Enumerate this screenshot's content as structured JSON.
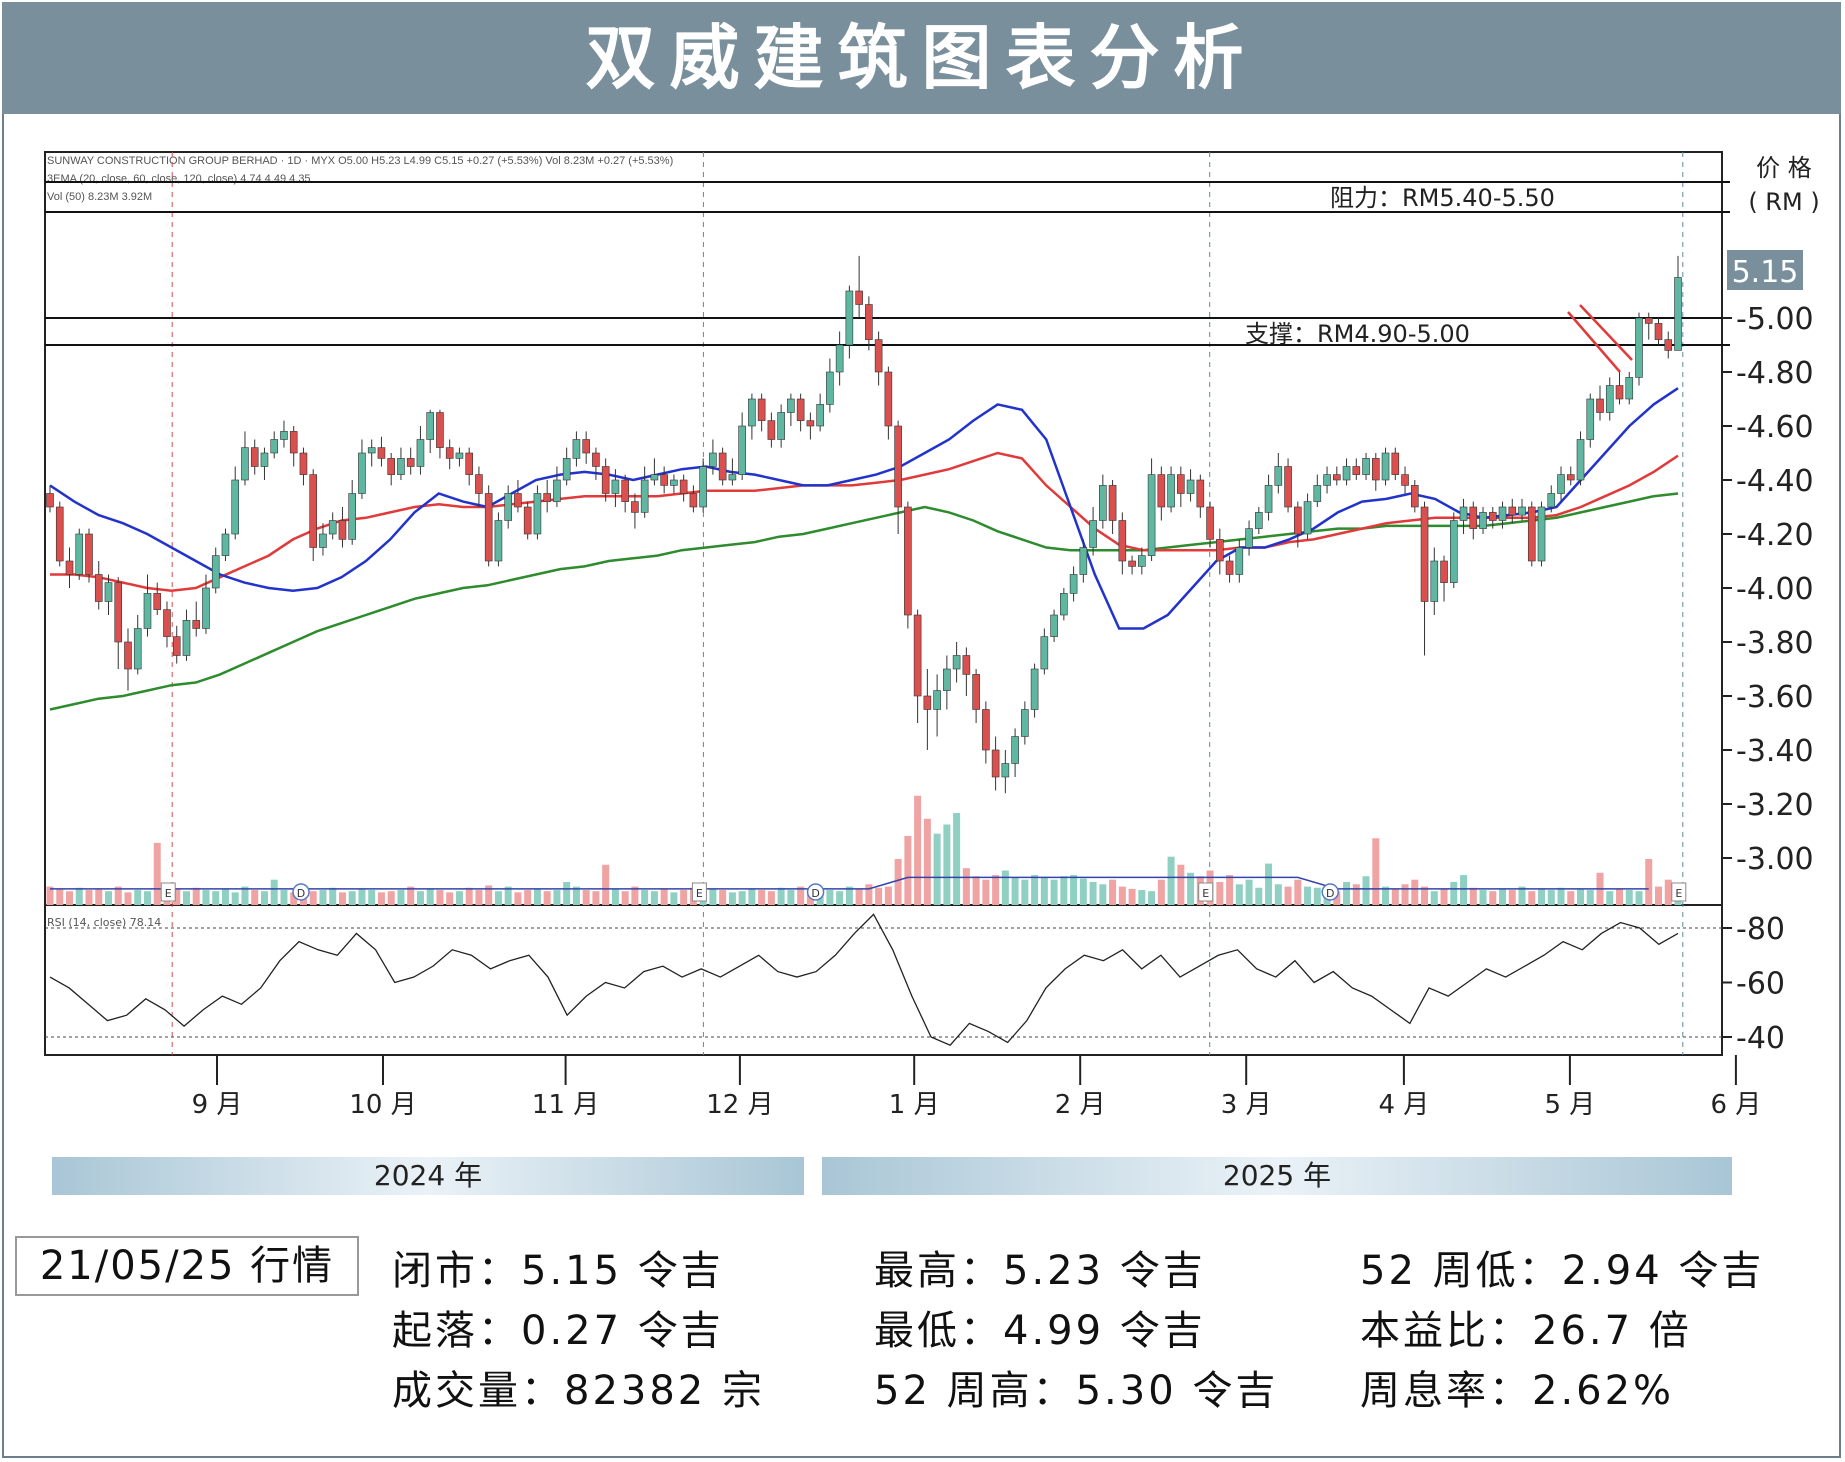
{
  "title": "双威建筑图表分析",
  "chart_data": {
    "type": "candlestick",
    "header_lines": [
      "SUNWAY CONSTRUCTION GROUP BERHAD · 1D · MYX  O5.00  H5.23  L4.99  C5.15  +0.27 (+5.53%)  Vol 8.23M +0.27 (+5.53%)",
      "3EMA (20, close, 60, close, 120, close)  4.74  4.49  4.35",
      "Vol (50)  8.23M  3.92M"
    ],
    "y_axis_title": "价 格",
    "y_axis_unit": "( RM )",
    "price_ticks": [
      "5.00",
      "4.80",
      "4.60",
      "4.40",
      "4.20",
      "4.00",
      "3.80",
      "3.60",
      "3.40",
      "3.20",
      "3.00"
    ],
    "ylim": [
      2.9,
      5.68
    ],
    "last_price_label": "5.15",
    "resistance": {
      "label": "阻力：RM5.40-5.50",
      "low": 5.4,
      "high": 5.5
    },
    "support": {
      "label": "支撑：RM4.90-5.00",
      "low": 4.9,
      "high": 5.0
    },
    "x_ticks": [
      "9 月",
      "10 月",
      "11 月",
      "12 月",
      "1 月",
      "2 月",
      "3 月",
      "4 月",
      "5 月",
      "6 月"
    ],
    "x_tick_pos": [
      0.5,
      1.5,
      2.6,
      3.65,
      4.7,
      5.7,
      6.7,
      7.65,
      8.65,
      9.65
    ],
    "years": [
      "2024 年",
      "2025 年"
    ],
    "event_markers": [
      {
        "label": "E",
        "x": 0.2
      },
      {
        "label": "D",
        "x": 1.0
      },
      {
        "label": "E",
        "x": 3.4
      },
      {
        "label": "D",
        "x": 4.1
      },
      {
        "label": "E",
        "x": 6.45
      },
      {
        "label": "D",
        "x": 7.2
      },
      {
        "label": "E",
        "x": 9.3
      }
    ],
    "rsi_label": "RSI (14, close)  78.14",
    "rsi_ticks": [
      "80",
      "60",
      "40"
    ],
    "rsi_levels": [
      80,
      40
    ],
    "candles": [
      [
        4.35,
        4.3,
        4.38,
        4.28
      ],
      [
        4.3,
        4.1,
        4.32,
        4.08
      ],
      [
        4.1,
        4.05,
        4.15,
        4.0
      ],
      [
        4.05,
        4.2,
        4.22,
        4.03
      ],
      [
        4.2,
        4.05,
        4.22,
        4.02
      ],
      [
        4.05,
        3.95,
        4.1,
        3.92
      ],
      [
        3.95,
        4.02,
        4.05,
        3.9
      ],
      [
        4.02,
        3.8,
        4.04,
        3.7
      ],
      [
        3.8,
        3.7,
        3.85,
        3.62
      ],
      [
        3.7,
        3.85,
        3.9,
        3.68
      ],
      [
        3.85,
        3.98,
        4.05,
        3.82
      ],
      [
        3.98,
        3.92,
        4.02,
        3.9
      ],
      [
        3.92,
        3.82,
        3.95,
        3.78
      ],
      [
        3.82,
        3.75,
        3.86,
        3.72
      ],
      [
        3.75,
        3.88,
        3.92,
        3.73
      ],
      [
        3.88,
        3.85,
        3.95,
        3.82
      ],
      [
        3.85,
        4.0,
        4.05,
        3.83
      ],
      [
        4.0,
        4.12,
        4.15,
        3.98
      ],
      [
        4.12,
        4.2,
        4.22,
        4.1
      ],
      [
        4.2,
        4.4,
        4.45,
        4.18
      ],
      [
        4.4,
        4.52,
        4.58,
        4.38
      ],
      [
        4.52,
        4.45,
        4.55,
        4.42
      ],
      [
        4.45,
        4.5,
        4.52,
        4.4
      ],
      [
        4.5,
        4.55,
        4.58,
        4.48
      ],
      [
        4.55,
        4.58,
        4.62,
        4.52
      ],
      [
        4.58,
        4.5,
        4.6,
        4.45
      ],
      [
        4.5,
        4.42,
        4.52,
        4.38
      ],
      [
        4.42,
        4.15,
        4.44,
        4.1
      ],
      [
        4.15,
        4.2,
        4.24,
        4.12
      ],
      [
        4.2,
        4.25,
        4.28,
        4.18
      ],
      [
        4.25,
        4.18,
        4.3,
        4.15
      ],
      [
        4.18,
        4.35,
        4.4,
        4.16
      ],
      [
        4.35,
        4.5,
        4.55,
        4.33
      ],
      [
        4.5,
        4.52,
        4.55,
        4.45
      ],
      [
        4.52,
        4.48,
        4.56,
        4.45
      ],
      [
        4.48,
        4.42,
        4.5,
        4.38
      ],
      [
        4.42,
        4.48,
        4.52,
        4.4
      ],
      [
        4.48,
        4.45,
        4.52,
        4.42
      ],
      [
        4.45,
        4.55,
        4.6,
        4.42
      ],
      [
        4.55,
        4.65,
        4.66,
        4.5
      ],
      [
        4.65,
        4.52,
        4.66,
        4.48
      ],
      [
        4.52,
        4.48,
        4.55,
        4.44
      ],
      [
        4.48,
        4.5,
        4.52,
        4.45
      ],
      [
        4.5,
        4.42,
        4.52,
        4.38
      ],
      [
        4.42,
        4.35,
        4.45,
        4.3
      ],
      [
        4.35,
        4.1,
        4.38,
        4.08
      ],
      [
        4.1,
        4.25,
        4.28,
        4.08
      ],
      [
        4.25,
        4.35,
        4.38,
        4.22
      ],
      [
        4.35,
        4.3,
        4.4,
        4.28
      ],
      [
        4.3,
        4.2,
        4.32,
        4.18
      ],
      [
        4.2,
        4.35,
        4.38,
        4.18
      ],
      [
        4.35,
        4.32,
        4.4,
        4.28
      ],
      [
        4.32,
        4.4,
        4.45,
        4.3
      ],
      [
        4.4,
        4.48,
        4.52,
        4.38
      ],
      [
        4.48,
        4.55,
        4.58,
        4.45
      ],
      [
        4.55,
        4.5,
        4.58,
        4.46
      ],
      [
        4.5,
        4.45,
        4.52,
        4.4
      ],
      [
        4.45,
        4.35,
        4.48,
        4.32
      ],
      [
        4.35,
        4.4,
        4.44,
        4.3
      ],
      [
        4.4,
        4.32,
        4.42,
        4.28
      ],
      [
        4.32,
        4.28,
        4.35,
        4.22
      ],
      [
        4.28,
        4.4,
        4.45,
        4.26
      ],
      [
        4.4,
        4.42,
        4.48,
        4.38
      ],
      [
        4.42,
        4.38,
        4.45,
        4.35
      ],
      [
        4.38,
        4.4,
        4.42,
        4.35
      ],
      [
        4.4,
        4.35,
        4.42,
        4.32
      ],
      [
        4.35,
        4.3,
        4.38,
        4.28
      ],
      [
        4.3,
        4.45,
        4.48,
        4.28
      ],
      [
        4.45,
        4.5,
        4.55,
        4.42
      ],
      [
        4.5,
        4.4,
        4.52,
        4.38
      ],
      [
        4.4,
        4.42,
        4.48,
        4.38
      ],
      [
        4.42,
        4.6,
        4.65,
        4.4
      ],
      [
        4.6,
        4.7,
        4.72,
        4.55
      ],
      [
        4.7,
        4.62,
        4.72,
        4.58
      ],
      [
        4.62,
        4.55,
        4.65,
        4.52
      ],
      [
        4.55,
        4.65,
        4.68,
        4.52
      ],
      [
        4.65,
        4.7,
        4.72,
        4.6
      ],
      [
        4.7,
        4.62,
        4.72,
        4.58
      ],
      [
        4.62,
        4.6,
        4.65,
        4.55
      ],
      [
        4.6,
        4.68,
        4.72,
        4.58
      ],
      [
        4.68,
        4.8,
        4.85,
        4.65
      ],
      [
        4.8,
        4.9,
        4.95,
        4.75
      ],
      [
        4.9,
        5.1,
        5.12,
        4.85
      ],
      [
        5.1,
        5.05,
        5.23,
        5.0
      ],
      [
        5.05,
        4.92,
        5.08,
        4.88
      ],
      [
        4.92,
        4.8,
        4.95,
        4.75
      ],
      [
        4.8,
        4.6,
        4.82,
        4.55
      ],
      [
        4.6,
        4.3,
        4.62,
        4.2
      ],
      [
        4.3,
        3.9,
        4.32,
        3.85
      ],
      [
        3.9,
        3.6,
        3.92,
        3.5
      ],
      [
        3.6,
        3.55,
        3.7,
        3.4
      ],
      [
        3.55,
        3.62,
        3.68,
        3.45
      ],
      [
        3.62,
        3.7,
        3.75,
        3.55
      ],
      [
        3.7,
        3.75,
        3.8,
        3.65
      ],
      [
        3.75,
        3.68,
        3.78,
        3.6
      ],
      [
        3.68,
        3.55,
        3.7,
        3.5
      ],
      [
        3.55,
        3.4,
        3.58,
        3.35
      ],
      [
        3.4,
        3.3,
        3.45,
        3.25
      ],
      [
        3.3,
        3.35,
        3.4,
        3.24
      ],
      [
        3.35,
        3.45,
        3.48,
        3.3
      ],
      [
        3.45,
        3.55,
        3.58,
        3.42
      ],
      [
        3.55,
        3.7,
        3.72,
        3.52
      ],
      [
        3.7,
        3.82,
        3.85,
        3.68
      ],
      [
        3.82,
        3.9,
        3.92,
        3.8
      ],
      [
        3.9,
        3.98,
        4.0,
        3.88
      ],
      [
        3.98,
        4.05,
        4.08,
        3.95
      ],
      [
        4.05,
        4.15,
        4.18,
        4.02
      ],
      [
        4.15,
        4.25,
        4.3,
        4.12
      ],
      [
        4.25,
        4.38,
        4.42,
        4.22
      ],
      [
        4.38,
        4.25,
        4.4,
        4.2
      ],
      [
        4.25,
        4.1,
        4.28,
        4.05
      ],
      [
        4.1,
        4.08,
        4.12,
        4.05
      ],
      [
        4.08,
        4.12,
        4.15,
        4.05
      ],
      [
        4.12,
        4.42,
        4.48,
        4.1
      ],
      [
        4.42,
        4.3,
        4.45,
        4.25
      ],
      [
        4.3,
        4.42,
        4.45,
        4.28
      ],
      [
        4.42,
        4.35,
        4.45,
        4.3
      ],
      [
        4.35,
        4.4,
        4.44,
        4.32
      ],
      [
        4.4,
        4.3,
        4.42,
        4.26
      ],
      [
        4.3,
        4.18,
        4.32,
        4.15
      ],
      [
        4.18,
        4.1,
        4.22,
        4.05
      ],
      [
        4.1,
        4.05,
        4.12,
        4.02
      ],
      [
        4.05,
        4.15,
        4.18,
        4.02
      ],
      [
        4.15,
        4.22,
        4.25,
        4.12
      ],
      [
        4.22,
        4.28,
        4.3,
        4.2
      ],
      [
        4.28,
        4.38,
        4.42,
        4.25
      ],
      [
        4.38,
        4.45,
        4.5,
        4.35
      ],
      [
        4.45,
        4.3,
        4.48,
        4.28
      ],
      [
        4.3,
        4.2,
        4.32,
        4.15
      ],
      [
        4.2,
        4.32,
        4.35,
        4.18
      ],
      [
        4.32,
        4.38,
        4.42,
        4.3
      ],
      [
        4.38,
        4.42,
        4.45,
        4.35
      ],
      [
        4.42,
        4.4,
        4.45,
        4.38
      ],
      [
        4.4,
        4.45,
        4.48,
        4.38
      ],
      [
        4.45,
        4.42,
        4.48,
        4.4
      ],
      [
        4.42,
        4.48,
        4.5,
        4.4
      ],
      [
        4.48,
        4.4,
        4.5,
        4.36
      ],
      [
        4.4,
        4.5,
        4.52,
        4.38
      ],
      [
        4.5,
        4.42,
        4.52,
        4.4
      ],
      [
        4.42,
        4.38,
        4.45,
        4.35
      ],
      [
        4.38,
        4.3,
        4.4,
        4.28
      ],
      [
        4.3,
        3.95,
        4.32,
        3.75
      ],
      [
        3.95,
        4.1,
        4.15,
        3.9
      ],
      [
        4.1,
        4.02,
        4.12,
        3.95
      ],
      [
        4.02,
        4.25,
        4.28,
        4.0
      ],
      [
        4.25,
        4.3,
        4.33,
        4.2
      ],
      [
        4.3,
        4.22,
        4.32,
        4.18
      ],
      [
        4.22,
        4.28,
        4.3,
        4.2
      ],
      [
        4.28,
        4.25,
        4.3,
        4.22
      ],
      [
        4.25,
        4.3,
        4.32,
        4.22
      ],
      [
        4.3,
        4.27,
        4.33,
        4.24
      ],
      [
        4.27,
        4.3,
        4.33,
        4.25
      ],
      [
        4.3,
        4.1,
        4.32,
        4.08
      ],
      [
        4.1,
        4.3,
        4.32,
        4.08
      ],
      [
        4.3,
        4.35,
        4.38,
        4.28
      ],
      [
        4.35,
        4.42,
        4.45,
        4.32
      ],
      [
        4.42,
        4.4,
        4.45,
        4.38
      ],
      [
        4.4,
        4.55,
        4.58,
        4.38
      ],
      [
        4.55,
        4.7,
        4.72,
        4.52
      ],
      [
        4.7,
        4.65,
        4.75,
        4.62
      ],
      [
        4.65,
        4.75,
        4.78,
        4.62
      ],
      [
        4.75,
        4.7,
        4.8,
        4.68
      ],
      [
        4.7,
        4.78,
        4.8,
        4.68
      ],
      [
        4.78,
        5.0,
        5.02,
        4.75
      ],
      [
        5.0,
        4.98,
        5.02,
        4.92
      ],
      [
        4.98,
        4.92,
        5.0,
        4.9
      ],
      [
        4.92,
        4.88,
        4.95,
        4.85
      ],
      [
        4.88,
        5.15,
        5.23,
        4.99
      ]
    ],
    "ema20": [
      4.38,
      4.32,
      4.27,
      4.24,
      4.2,
      4.15,
      4.1,
      4.05,
      4.02,
      4.0,
      3.99,
      4.0,
      4.04,
      4.1,
      4.18,
      4.28,
      4.35,
      4.32,
      4.3,
      4.35,
      4.4,
      4.42,
      4.43,
      4.42,
      4.4,
      4.42,
      4.44,
      4.45,
      4.43,
      4.42,
      4.4,
      4.38,
      4.38,
      4.4,
      4.42,
      4.45,
      4.5,
      4.55,
      4.62,
      4.68,
      4.66,
      4.55,
      4.3,
      4.05,
      3.85,
      3.85,
      3.9,
      4.0,
      4.1,
      4.15,
      4.15,
      4.18,
      4.22,
      4.28,
      4.32,
      4.33,
      4.35,
      4.33,
      4.28,
      4.26,
      4.27,
      4.28,
      4.3,
      4.4,
      4.5,
      4.6,
      4.68,
      4.74
    ],
    "ema60": [
      4.05,
      4.05,
      4.04,
      4.02,
      4.0,
      3.99,
      4.0,
      4.04,
      4.08,
      4.12,
      4.18,
      4.22,
      4.25,
      4.26,
      4.28,
      4.3,
      4.31,
      4.3,
      4.3,
      4.31,
      4.32,
      4.33,
      4.34,
      4.34,
      4.34,
      4.34,
      4.35,
      4.36,
      4.36,
      4.36,
      4.37,
      4.38,
      4.38,
      4.38,
      4.39,
      4.4,
      4.42,
      4.44,
      4.47,
      4.5,
      4.48,
      4.38,
      4.3,
      4.22,
      4.16,
      4.14,
      4.14,
      4.14,
      4.14,
      4.15,
      4.15,
      4.17,
      4.18,
      4.2,
      4.22,
      4.24,
      4.25,
      4.26,
      4.26,
      4.26,
      4.26,
      4.26,
      4.27,
      4.3,
      4.34,
      4.38,
      4.43,
      4.49
    ],
    "ema120": [
      3.55,
      3.57,
      3.59,
      3.6,
      3.62,
      3.64,
      3.65,
      3.68,
      3.72,
      3.76,
      3.8,
      3.84,
      3.87,
      3.9,
      3.93,
      3.96,
      3.98,
      4.0,
      4.01,
      4.03,
      4.05,
      4.07,
      4.08,
      4.1,
      4.11,
      4.12,
      4.14,
      4.15,
      4.16,
      4.17,
      4.19,
      4.2,
      4.22,
      4.24,
      4.26,
      4.28,
      4.3,
      4.28,
      4.25,
      4.21,
      4.18,
      4.15,
      4.14,
      4.14,
      4.14,
      4.14,
      4.15,
      4.16,
      4.17,
      4.18,
      4.19,
      4.2,
      4.21,
      4.22,
      4.22,
      4.23,
      4.23,
      4.23,
      4.23,
      4.23,
      4.24,
      4.25,
      4.26,
      4.28,
      4.3,
      4.32,
      4.34,
      4.35
    ],
    "rsi": [
      62,
      58,
      52,
      46,
      48,
      54,
      50,
      44,
      50,
      55,
      52,
      58,
      68,
      75,
      72,
      70,
      78,
      72,
      60,
      62,
      66,
      72,
      70,
      65,
      68,
      70,
      62,
      48,
      55,
      60,
      58,
      64,
      66,
      62,
      65,
      62,
      66,
      70,
      64,
      62,
      64,
      70,
      78,
      85,
      72,
      55,
      40,
      37,
      45,
      42,
      38,
      46,
      58,
      65,
      70,
      68,
      72,
      65,
      70,
      62,
      66,
      70,
      72,
      65,
      62,
      68,
      60,
      64,
      58,
      55,
      50,
      45,
      58,
      55,
      60,
      65,
      62,
      66,
      70,
      75,
      72,
      78,
      82,
      80,
      74,
      78
    ],
    "volume": [
      1.6,
      1.4,
      1.2,
      1.5,
      1.3,
      1.4,
      1.2,
      1.6,
      1.1,
      1.3,
      1.2,
      5.4,
      1.8,
      1.4,
      1.2,
      1.5,
      1.3,
      1.2,
      1.4,
      1.1,
      1.6,
      1.3,
      1.2,
      2.2,
      1.3,
      1.1,
      1.4,
      1.2,
      1.3,
      1.5,
      1.1,
      1.2,
      1.4,
      1.3,
      1.1,
      1.2,
      1.3,
      1.6,
      1.2,
      1.4,
      1.3,
      1.1,
      1.2,
      1.5,
      1.3,
      1.7,
      1.2,
      1.6,
      1.1,
      1.3,
      1.4,
      1.2,
      1.3,
      2.0,
      1.6,
      1.3,
      1.2,
      3.5,
      1.4,
      1.2,
      1.6,
      1.3,
      1.2,
      1.4,
      1.1,
      1.3,
      1.5,
      1.2,
      1.4,
      1.3,
      1.1,
      1.2,
      1.4,
      1.3,
      1.2,
      1.5,
      1.3,
      1.6,
      1.2,
      1.4,
      1.3,
      1.2,
      1.6,
      1.4,
      1.8,
      1.5,
      1.6,
      4.0,
      6.0,
      9.5,
      7.5,
      6.2,
      7.0,
      8.0,
      3.2,
      2.5,
      2.2,
      2.6,
      3.0,
      2.4,
      2.2,
      2.6,
      2.4,
      2.2,
      2.5,
      2.6,
      2.3,
      2.0,
      1.8,
      2.2,
      1.6,
      1.4,
      1.3,
      1.2,
      2.2,
      4.2,
      3.5,
      2.8,
      2.5,
      3.0,
      2.0,
      2.6,
      1.8,
      2.2,
      1.5,
      3.6,
      1.8,
      1.6,
      2.2,
      1.6,
      1.5,
      1.4,
      1.2,
      2.0,
      1.8,
      2.5,
      5.8,
      1.6,
      1.4,
      1.8,
      2.2,
      1.6,
      1.2,
      1.4,
      2.0,
      2.6,
      1.5,
      1.3,
      1.2,
      1.4,
      1.3,
      1.6,
      1.2,
      1.4,
      1.3,
      1.5,
      1.2,
      1.4,
      1.3,
      2.8,
      1.2,
      1.4,
      1.3,
      1.2,
      4.0,
      1.6,
      2.2,
      1.5,
      2.6
    ]
  },
  "quote": {
    "date": "21/05/25 行情",
    "close": "闭市：5.15 令吉",
    "change": "起落：0.27 令吉",
    "volume": "成交量：82382 宗",
    "high": "最高：5.23 令吉",
    "low": "最低：4.99 令吉",
    "high52": "52 周高：5.30 令吉",
    "low52": "52 周低：2.94 令吉",
    "pe": "本益比：26.7 倍",
    "dy": "周息率：2.62%"
  },
  "colors": {
    "up": "#5fb7a2",
    "down": "#d9504f",
    "ema20": "#2233cc",
    "ema60": "#e03a3a",
    "ema120": "#2e8b2e",
    "vol_up": "#8fd0c2",
    "vol_down": "#f0a3a3",
    "title_bg": "#7a8f9c",
    "trend": "#e03a3a"
  }
}
